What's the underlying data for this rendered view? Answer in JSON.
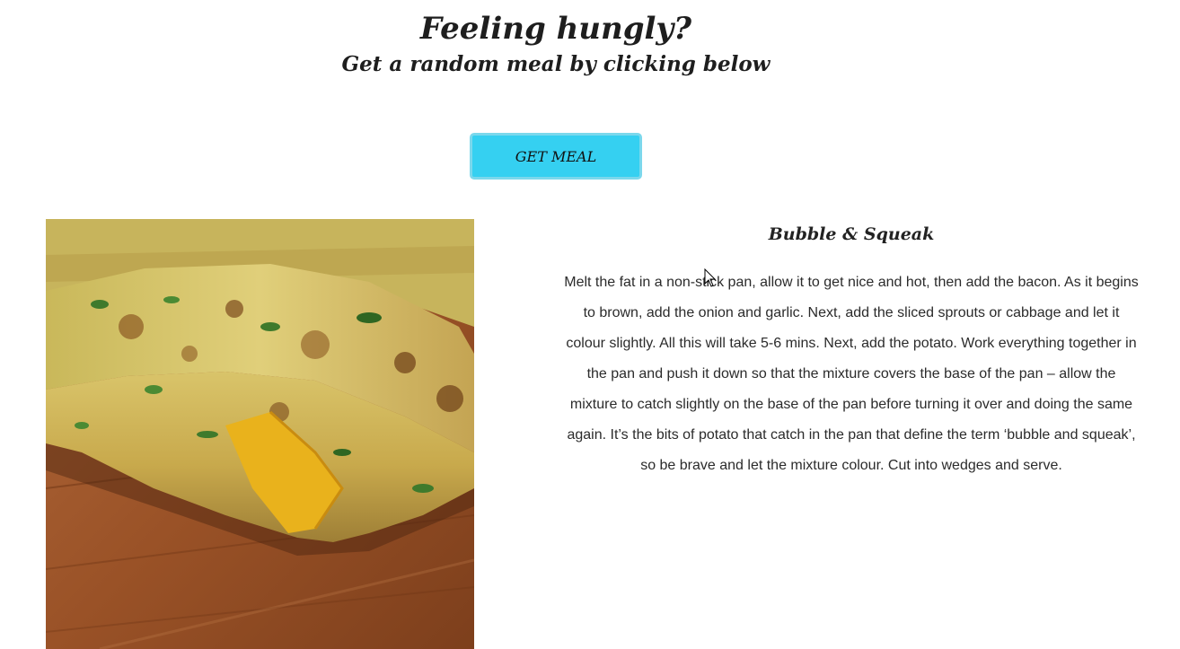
{
  "header": {
    "title": "Feeling hungly?",
    "subtitle": "Get a random meal by clicking below"
  },
  "actions": {
    "get_meal_label": "GET MEAL"
  },
  "meal": {
    "name": "Bubble & Squeak",
    "instructions": "Melt the fat in a non-stick pan, allow it to get nice and hot, then add the bacon. As it begins to brown, add the onion and garlic. Next, add the sliced sprouts or cabbage and let it colour slightly. All this will take 5-6 mins. Next, add the potato. Work everything together in the pan and push it down so that the mixture covers the base of the pan – allow the mixture to catch slightly on the base of the pan before turning it over and doing the same again. It’s the bits of potato that catch in the pan that define the term ‘bubble and squeak’, so be brave and let the mixture colour. Cut into wedges and serve.",
    "image_icon": "meal-photo"
  },
  "colors": {
    "button_fill": "#35d0f1",
    "button_border": "#7bd8ec",
    "text": "#1e1e1e"
  }
}
